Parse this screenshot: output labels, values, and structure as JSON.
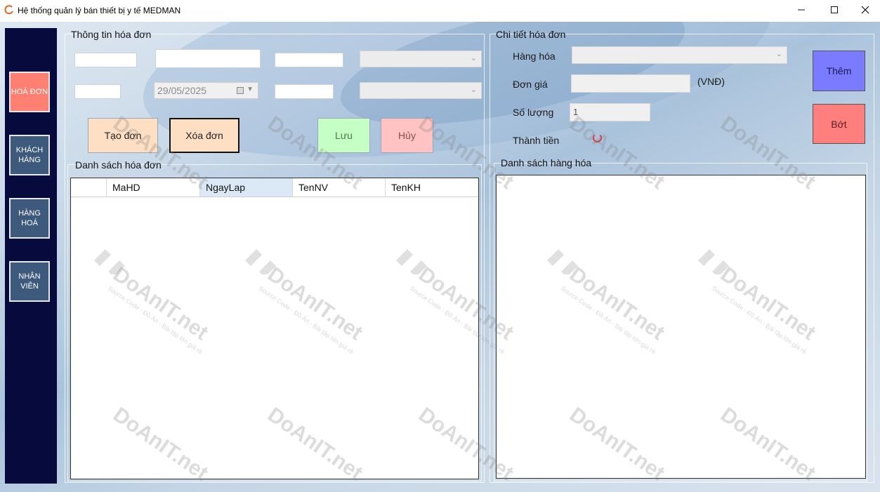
{
  "window": {
    "title": "Hệ thống quản lý bán thiết bị y tế MEDMAN",
    "minimize_icon": "minimize-icon",
    "maximize_icon": "maximize-icon",
    "close_icon": "close-icon"
  },
  "sidebar": {
    "items": [
      {
        "label": "HOÁ ĐƠN",
        "active": true
      },
      {
        "label": "KHÁCH HÀNG",
        "active": false
      },
      {
        "label": "HÀNG HOÁ",
        "active": false
      },
      {
        "label": "NHÂN VIÊN",
        "active": false
      }
    ]
  },
  "invoice_info": {
    "title": "Thông tin hóa đơn",
    "date_value": "29/05/2025",
    "buttons": {
      "create": "Tạo đơn",
      "delete": "Xóa đơn",
      "save": "Lưu",
      "cancel": "Hủy"
    }
  },
  "invoice_list": {
    "title": "Danh sách hóa đơn",
    "columns": [
      "MaHD",
      "NgayLap",
      "TenNV",
      "TenKH"
    ],
    "rows": []
  },
  "invoice_detail": {
    "title": "Chi tiết hóa đơn",
    "labels": {
      "product": "Hàng hóa",
      "unit_price": "Đơn giá",
      "currency": "(VNĐ)",
      "quantity": "Số lượng",
      "total": "Thành tiền"
    },
    "quantity_value": "1",
    "buttons": {
      "add": "Thêm",
      "remove": "Bớt"
    }
  },
  "product_list": {
    "title": "Danh sách hàng hóa",
    "rows": []
  },
  "watermark": {
    "brand": "DoAnIT.net",
    "tagline": "Source Code - Đồ Án - Bài tập lớn giá rẻ"
  },
  "colors": {
    "sidebar_bg": "#070a3d",
    "nav_active": "#ff7f72",
    "nav_inactive": "#3d5a7c",
    "btn_create": "#ffdfc3",
    "btn_save": "#c6ffc5",
    "btn_cancel": "#ffc3c4",
    "btn_add": "#7b7bff",
    "btn_remove": "#ff7f7f"
  }
}
